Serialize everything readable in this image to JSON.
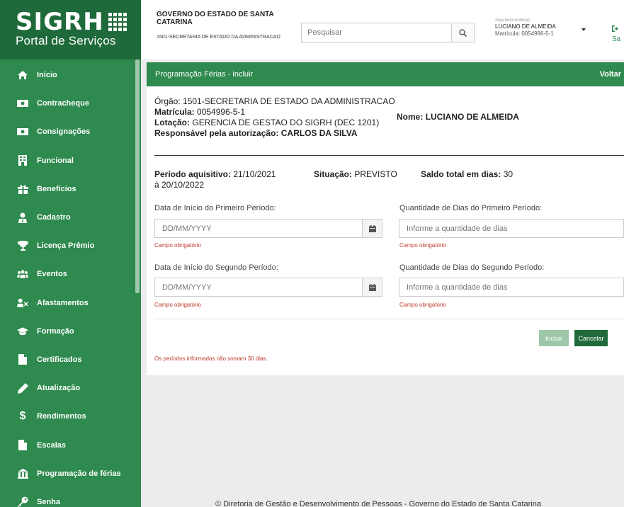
{
  "logo": {
    "main": "SIGRH",
    "sub": "Portal de Serviços"
  },
  "header": {
    "gov_title": "GOVERNO DO ESTADO DE SANTA CATARINA",
    "gov_sub": "1501-SECRETARIA DE ESTADO DA ADMINISTRACAO",
    "search_placeholder": "Pesquisar",
    "welcome": "Seja bem vindo(a)",
    "user_name": "LUCIANO DE ALMEIDA",
    "user_mat": "Matrícula: 0054996-5-1",
    "logout": "Sa"
  },
  "sidebar": {
    "items": [
      {
        "label": "Início",
        "icon": "home-icon"
      },
      {
        "label": "Contracheque",
        "icon": "money-icon"
      },
      {
        "label": "Consignações",
        "icon": "money-icon"
      },
      {
        "label": "Funcional",
        "icon": "building-icon"
      },
      {
        "label": "Benefícios",
        "icon": "gift-icon"
      },
      {
        "label": "Cadastro",
        "icon": "user-tie-icon"
      },
      {
        "label": "Licença Prêmio",
        "icon": "trophy-icon"
      },
      {
        "label": "Eventos",
        "icon": "users-icon"
      },
      {
        "label": "Afastamentos",
        "icon": "user-times-icon"
      },
      {
        "label": "Formação",
        "icon": "graduation-cap-icon"
      },
      {
        "label": "Certificados",
        "icon": "file-icon"
      },
      {
        "label": "Atualização",
        "icon": "pencil-icon"
      },
      {
        "label": "Rendimentos",
        "icon": "dollar-icon"
      },
      {
        "label": "Escalas",
        "icon": "file-icon"
      },
      {
        "label": "Programação de férias",
        "icon": "bank-icon"
      },
      {
        "label": "Senha",
        "icon": "key-icon"
      }
    ]
  },
  "panel": {
    "title": "Programação Férias - incluir",
    "back": "Voltar",
    "orgao_label": "Órgão:",
    "orgao_value": "1501-SECRETARIA DE ESTADO DA ADMINISTRACAO",
    "matricula_label": "Matrícula:",
    "matricula_value": "0054996-5-1",
    "nome_label": "Nome:",
    "nome_value": "LUCIANO DE ALMEIDA",
    "lotacao_label": "Lotação:",
    "lotacao_value": "GERENCIA DE GESTAO DO SIGRH (DEC 1201)",
    "responsavel_label": "Responsável pela autorização:",
    "responsavel_value": "CARLOS DA SILVA",
    "periodo_label": "Período aquisitivo:",
    "periodo_value": "21/10/2021 à 20/10/2022",
    "situacao_label": "Situação:",
    "situacao_value": "PREVISTO",
    "saldo_label": "Saldo total em dias:",
    "saldo_value": "30",
    "data_inicio_1_label": "Data de Início do Primeiro Período:",
    "qtd_1_label": "Quantidade de Dias do Primeiro Período:",
    "data_inicio_2_label": "Data de Início do Segundo Período:",
    "qtd_2_label": "Quantidade de Dias do Segundo Período:",
    "date_placeholder": "DD/MM/YYYY",
    "qty_placeholder": "Informe a quantidade de dias",
    "required": "Campo obrigatório",
    "incluir": "Incluir",
    "cancelar": "Cancelar",
    "error": "Os períodos informados não somam 30 dias."
  },
  "footer": "© Diretoria de Gestão e Desenvolvimento de Pessoas - Governo do Estado de Santa Catarina",
  "colors": {
    "primary": "#2e8a4e",
    "dark": "#1f6a3a",
    "error": "#c0392b"
  }
}
